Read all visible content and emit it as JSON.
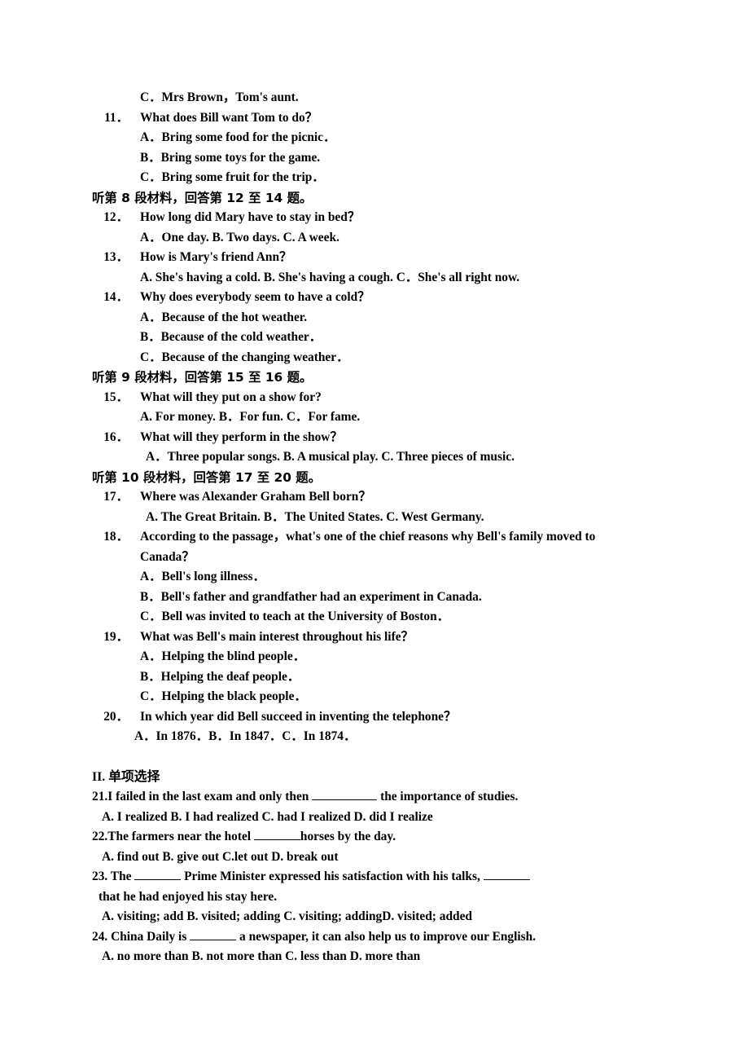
{
  "document": {
    "type": "english-exam-paper",
    "page_background": "#ffffff",
    "text_color": "#000000"
  },
  "listening": {
    "orphan_option": "C．Mrs Brown，Tom's aunt.",
    "questions": [
      {
        "num": "11．",
        "text": "What does Bill want Tom to do？",
        "options": [
          "A．Bring some food for the picnic．",
          "B．Bring some toys for the game.",
          "C．Bring some fruit for the trip．"
        ]
      },
      {
        "num": "12．",
        "text": "How long did Mary have to stay in bed？",
        "options": [
          "A．One day. B. Two days. C. A week."
        ]
      },
      {
        "num": "13．",
        "text": "How is Mary's friend Ann？",
        "options": [
          "A. She's having a cold. B. She's having a cough. C．She's all right now."
        ]
      },
      {
        "num": "14．",
        "text": "Why does everybody seem to have a cold？",
        "options": [
          "A．Because of the hot weather.",
          "B．Because of the cold weather．",
          "C．Because of the changing weather．"
        ]
      },
      {
        "num": "15．",
        "text": "What will they put on a show for?",
        "options": [
          "A. For money. B．For fun. C．For fame."
        ]
      },
      {
        "num": "16．",
        "text": "What will they perform in the show？",
        "options": [
          "A．Three popular songs. B. A musical play. C. Three pieces of music."
        ]
      },
      {
        "num": "17．",
        "text": "Where was Alexander Graham Bell born？",
        "options": [
          "A. The Great Britain. B．The United States. C. West Germany."
        ]
      },
      {
        "num": "18．",
        "text": "According to the passage，what's one of the chief reasons why Bell's family moved to Canada？",
        "options": [
          "A．Bell's long illness．",
          "B．Bell's father and grandfather had an experiment in Canada.",
          "C．Bell was invited to teach at the University of Boston．"
        ]
      },
      {
        "num": "19．",
        "text": "What was Bell's main interest throughout his life？",
        "options": [
          "A．Helping the blind people．",
          "B．Helping the deaf people．",
          "C．Helping the black people．"
        ]
      },
      {
        "num": "20．",
        "text": "In which year did Bell succeed in inventing the telephone？",
        "options": [
          "A．In 1876．B．In 1847．C．In 1874．"
        ]
      }
    ],
    "instructions": [
      "听第 8 段材料，回答第 12 至 14 题。",
      "听第 9 段材料，回答第 15 至 16 题。",
      "听第 10 段材料，回答第 17 至 20 题。"
    ]
  },
  "section_two": {
    "heading_roman": "II. ",
    "heading_cn": "单项选择",
    "questions": [
      {
        "num_text_before": "21.I failed in the last exam and only then ",
        "num_text_after": " the importance of studies.",
        "options_line": "A. I realized          B. I had realized          C. had I realized          D. did I realize"
      },
      {
        "num_text_before": "22.The farmers near the hotel ",
        "num_text_after": "horses by the day.",
        "options_line": "A. find out                B. give out              C.let out              D. break out"
      },
      {
        "q23_part1": "23. The ",
        "q23_part2": " Prime Minister expressed his satisfaction with his talks, ",
        "q23_line2": "that he had enjoyed his stay here.",
        "q23_options": "A. visiting; add B. visited; adding C. visiting; addingD. visited; added"
      },
      {
        "num_text_before": "24. China Daily is ",
        "num_text_after": " a newspaper, it can also help us to improve our English.",
        "options_line": "A. no more than          B. not more than          C. less than          D. more than"
      }
    ]
  }
}
